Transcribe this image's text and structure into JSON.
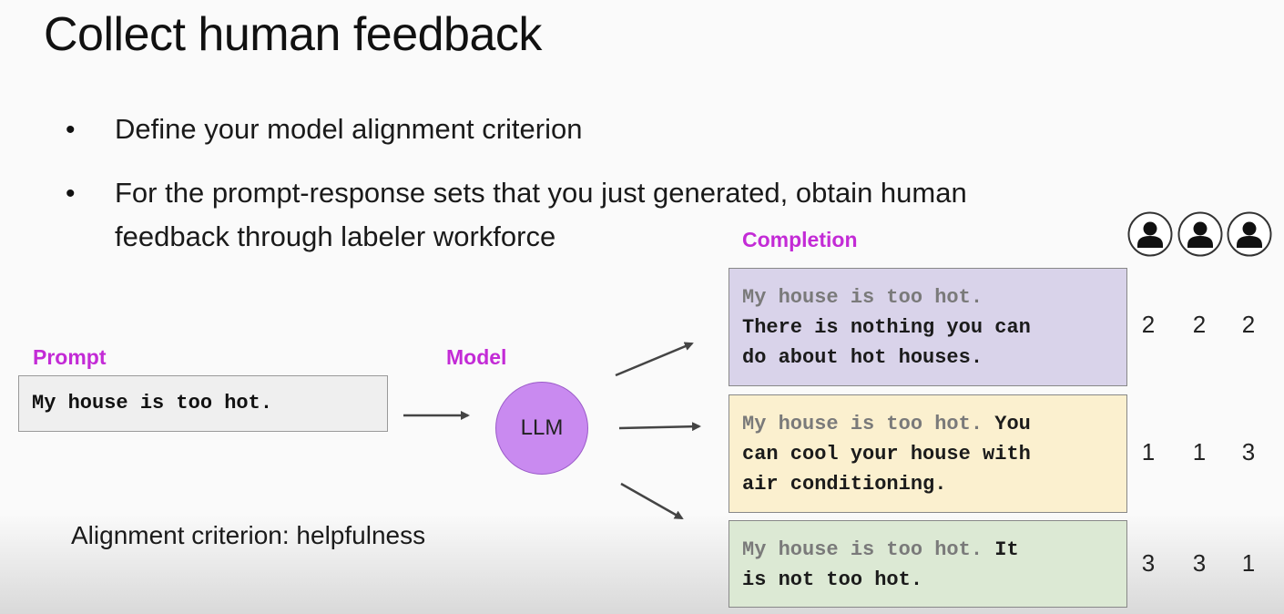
{
  "title": "Collect human feedback",
  "bullets": [
    "Define your model alignment criterion",
    "For the prompt-response sets that you just generated, obtain human",
    "feedback through labeler workforce"
  ],
  "labels": {
    "prompt": "Prompt",
    "model": "Model",
    "completion": "Completion"
  },
  "prompt_text": "My house is too hot.",
  "model_name": "LLM",
  "criterion": "Alignment criterion: helpfulness",
  "completions": [
    {
      "prefix": "My house is too hot.",
      "body": "\nThere is nothing you can\ndo about hot houses.",
      "bg": "#d9d3ea",
      "scores": [
        "2",
        "2",
        "2"
      ]
    },
    {
      "prefix": "My house is too hot.",
      "body": " You\ncan cool your house with\nair conditioning.",
      "bg": "#fbf0cf",
      "scores": [
        "1",
        "1",
        "3"
      ]
    },
    {
      "prefix": "My house is too hot.",
      "body": " It\nis not too hot.",
      "bg": "#dce9d4",
      "scores": [
        "3",
        "3",
        "1"
      ]
    }
  ],
  "labeler_icons": [
    "person-icon",
    "person-icon",
    "person-icon"
  ],
  "colors": {
    "accent": "#c32bd6",
    "llm_fill": "#c98af0",
    "prompt_fill": "#efefef"
  }
}
